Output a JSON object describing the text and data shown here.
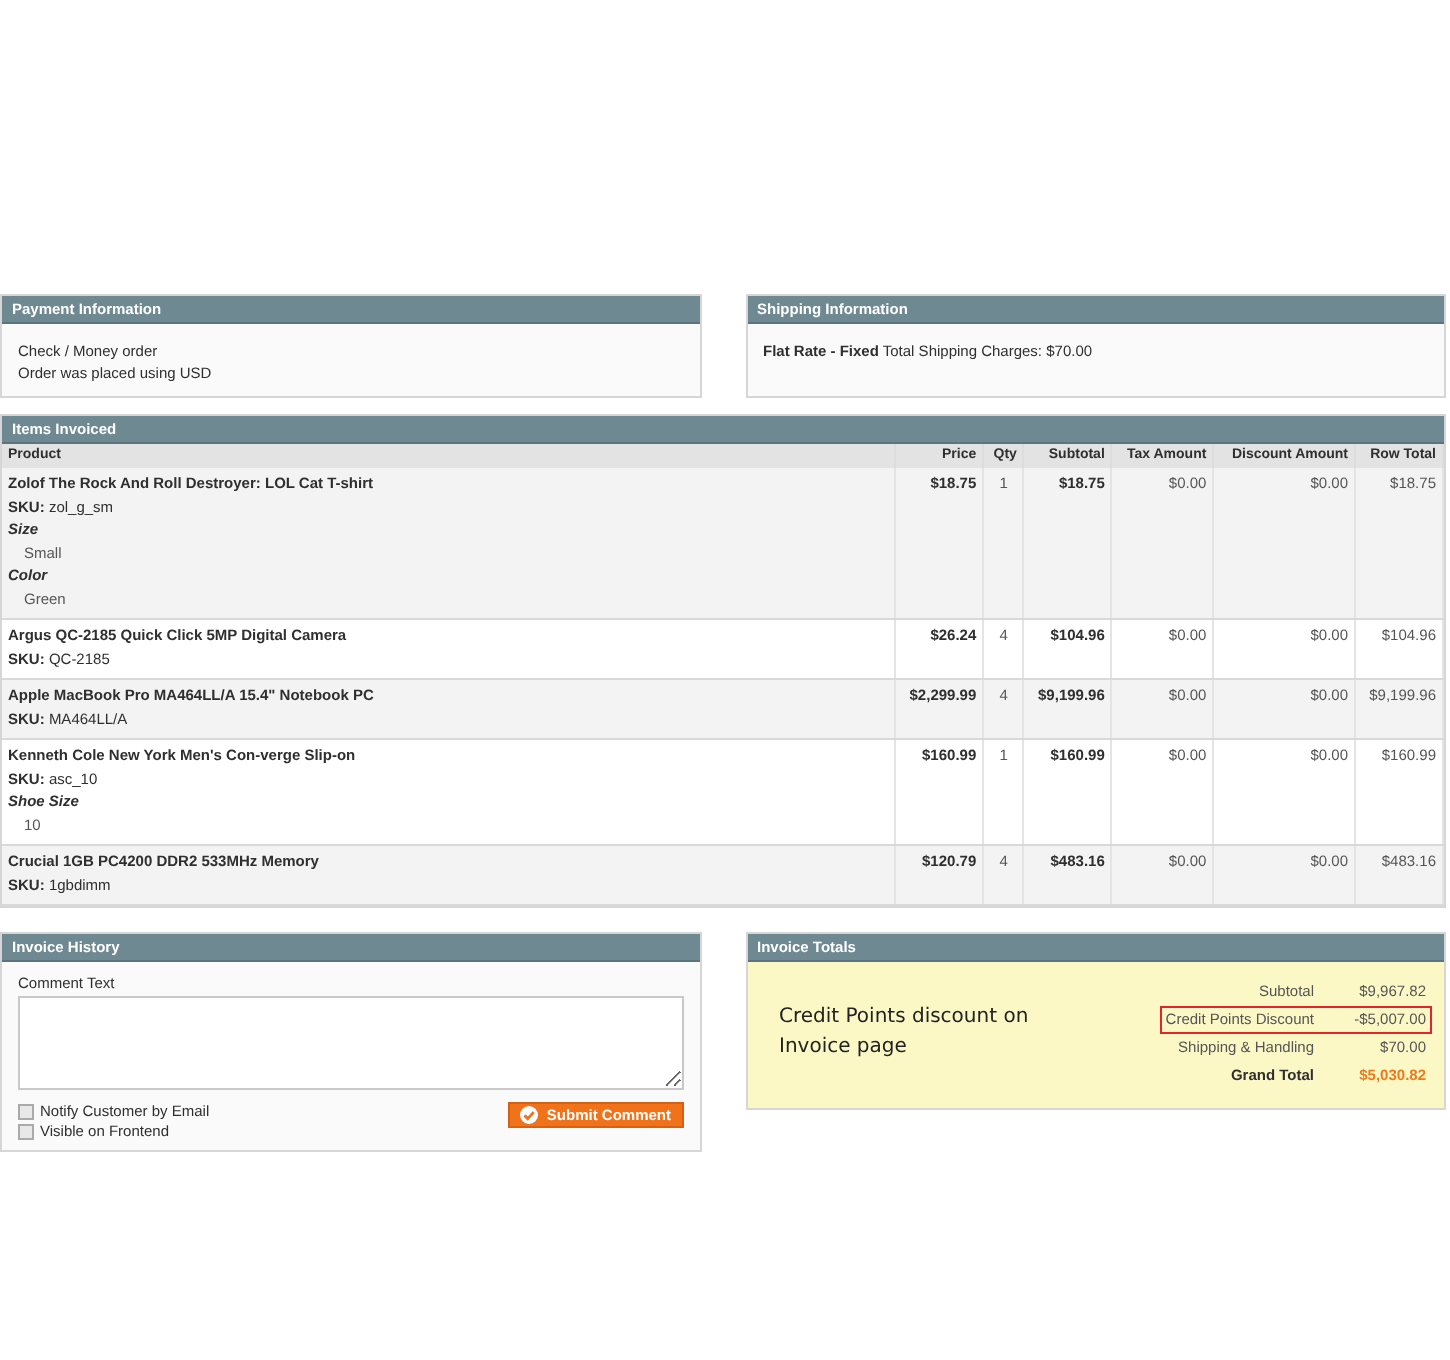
{
  "payment": {
    "title": "Payment Information",
    "lines": [
      "Check / Money order",
      "Order was placed using USD"
    ]
  },
  "shipping": {
    "title": "Shipping Information",
    "method": "Flat Rate - Fixed",
    "text": "Total Shipping Charges: $70.00"
  },
  "items": {
    "title": "Items Invoiced",
    "columns": [
      "Product",
      "Price",
      "Qty",
      "Subtotal",
      "Tax Amount",
      "Discount Amount",
      "Row Total"
    ],
    "rows": [
      {
        "name": "Zolof The Rock And Roll Destroyer: LOL Cat T-shirt",
        "sku_label": "SKU:",
        "sku": "zol_g_sm",
        "options": [
          {
            "label": "Size",
            "value": "Small"
          },
          {
            "label": "Color",
            "value": "Green"
          }
        ],
        "price": "$18.75",
        "qty": "1",
        "subtotal": "$18.75",
        "tax": "$0.00",
        "discount": "$0.00",
        "row_total": "$18.75"
      },
      {
        "name": "Argus QC-2185 Quick Click 5MP Digital Camera",
        "sku_label": "SKU:",
        "sku": "QC-2185",
        "options": [],
        "price": "$26.24",
        "qty": "4",
        "subtotal": "$104.96",
        "tax": "$0.00",
        "discount": "$0.00",
        "row_total": "$104.96"
      },
      {
        "name": "Apple MacBook Pro MA464LL/A 15.4\" Notebook PC",
        "sku_label": "SKU:",
        "sku": "MA464LL/A",
        "options": [],
        "price": "$2,299.99",
        "qty": "4",
        "subtotal": "$9,199.96",
        "tax": "$0.00",
        "discount": "$0.00",
        "row_total": "$9,199.96"
      },
      {
        "name": "Kenneth Cole New York Men's Con-verge Slip-on",
        "sku_label": "SKU:",
        "sku": "asc_10",
        "options": [
          {
            "label": "Shoe Size",
            "value": "10"
          }
        ],
        "price": "$160.99",
        "qty": "1",
        "subtotal": "$160.99",
        "tax": "$0.00",
        "discount": "$0.00",
        "row_total": "$160.99"
      },
      {
        "name": "Crucial 1GB PC4200 DDR2 533MHz Memory",
        "sku_label": "SKU:",
        "sku": "1gbdimm",
        "options": [],
        "price": "$120.79",
        "qty": "4",
        "subtotal": "$483.16",
        "tax": "$0.00",
        "discount": "$0.00",
        "row_total": "$483.16"
      }
    ]
  },
  "history": {
    "title": "Invoice History",
    "comment_label": "Comment Text",
    "checkboxes": [
      {
        "label": "Notify Customer by Email",
        "checked": false
      },
      {
        "label": "Visible on Frontend",
        "checked": false
      }
    ],
    "submit": "Submit Comment"
  },
  "totals": {
    "title": "Invoice Totals",
    "note": "Credit Points discount on Invoice page",
    "rows": [
      {
        "kind": "normal",
        "label": "Subtotal",
        "value": "$9,967.82",
        "highlighted": false
      },
      {
        "kind": "normal",
        "label": "Credit Points Discount",
        "value": "-$5,007.00",
        "highlighted": true
      },
      {
        "kind": "normal",
        "label": "Shipping & Handling",
        "value": "$70.00",
        "highlighted": false
      },
      {
        "kind": "grand",
        "label": "Grand Total",
        "value": "$5,030.82",
        "highlighted": false
      }
    ]
  }
}
